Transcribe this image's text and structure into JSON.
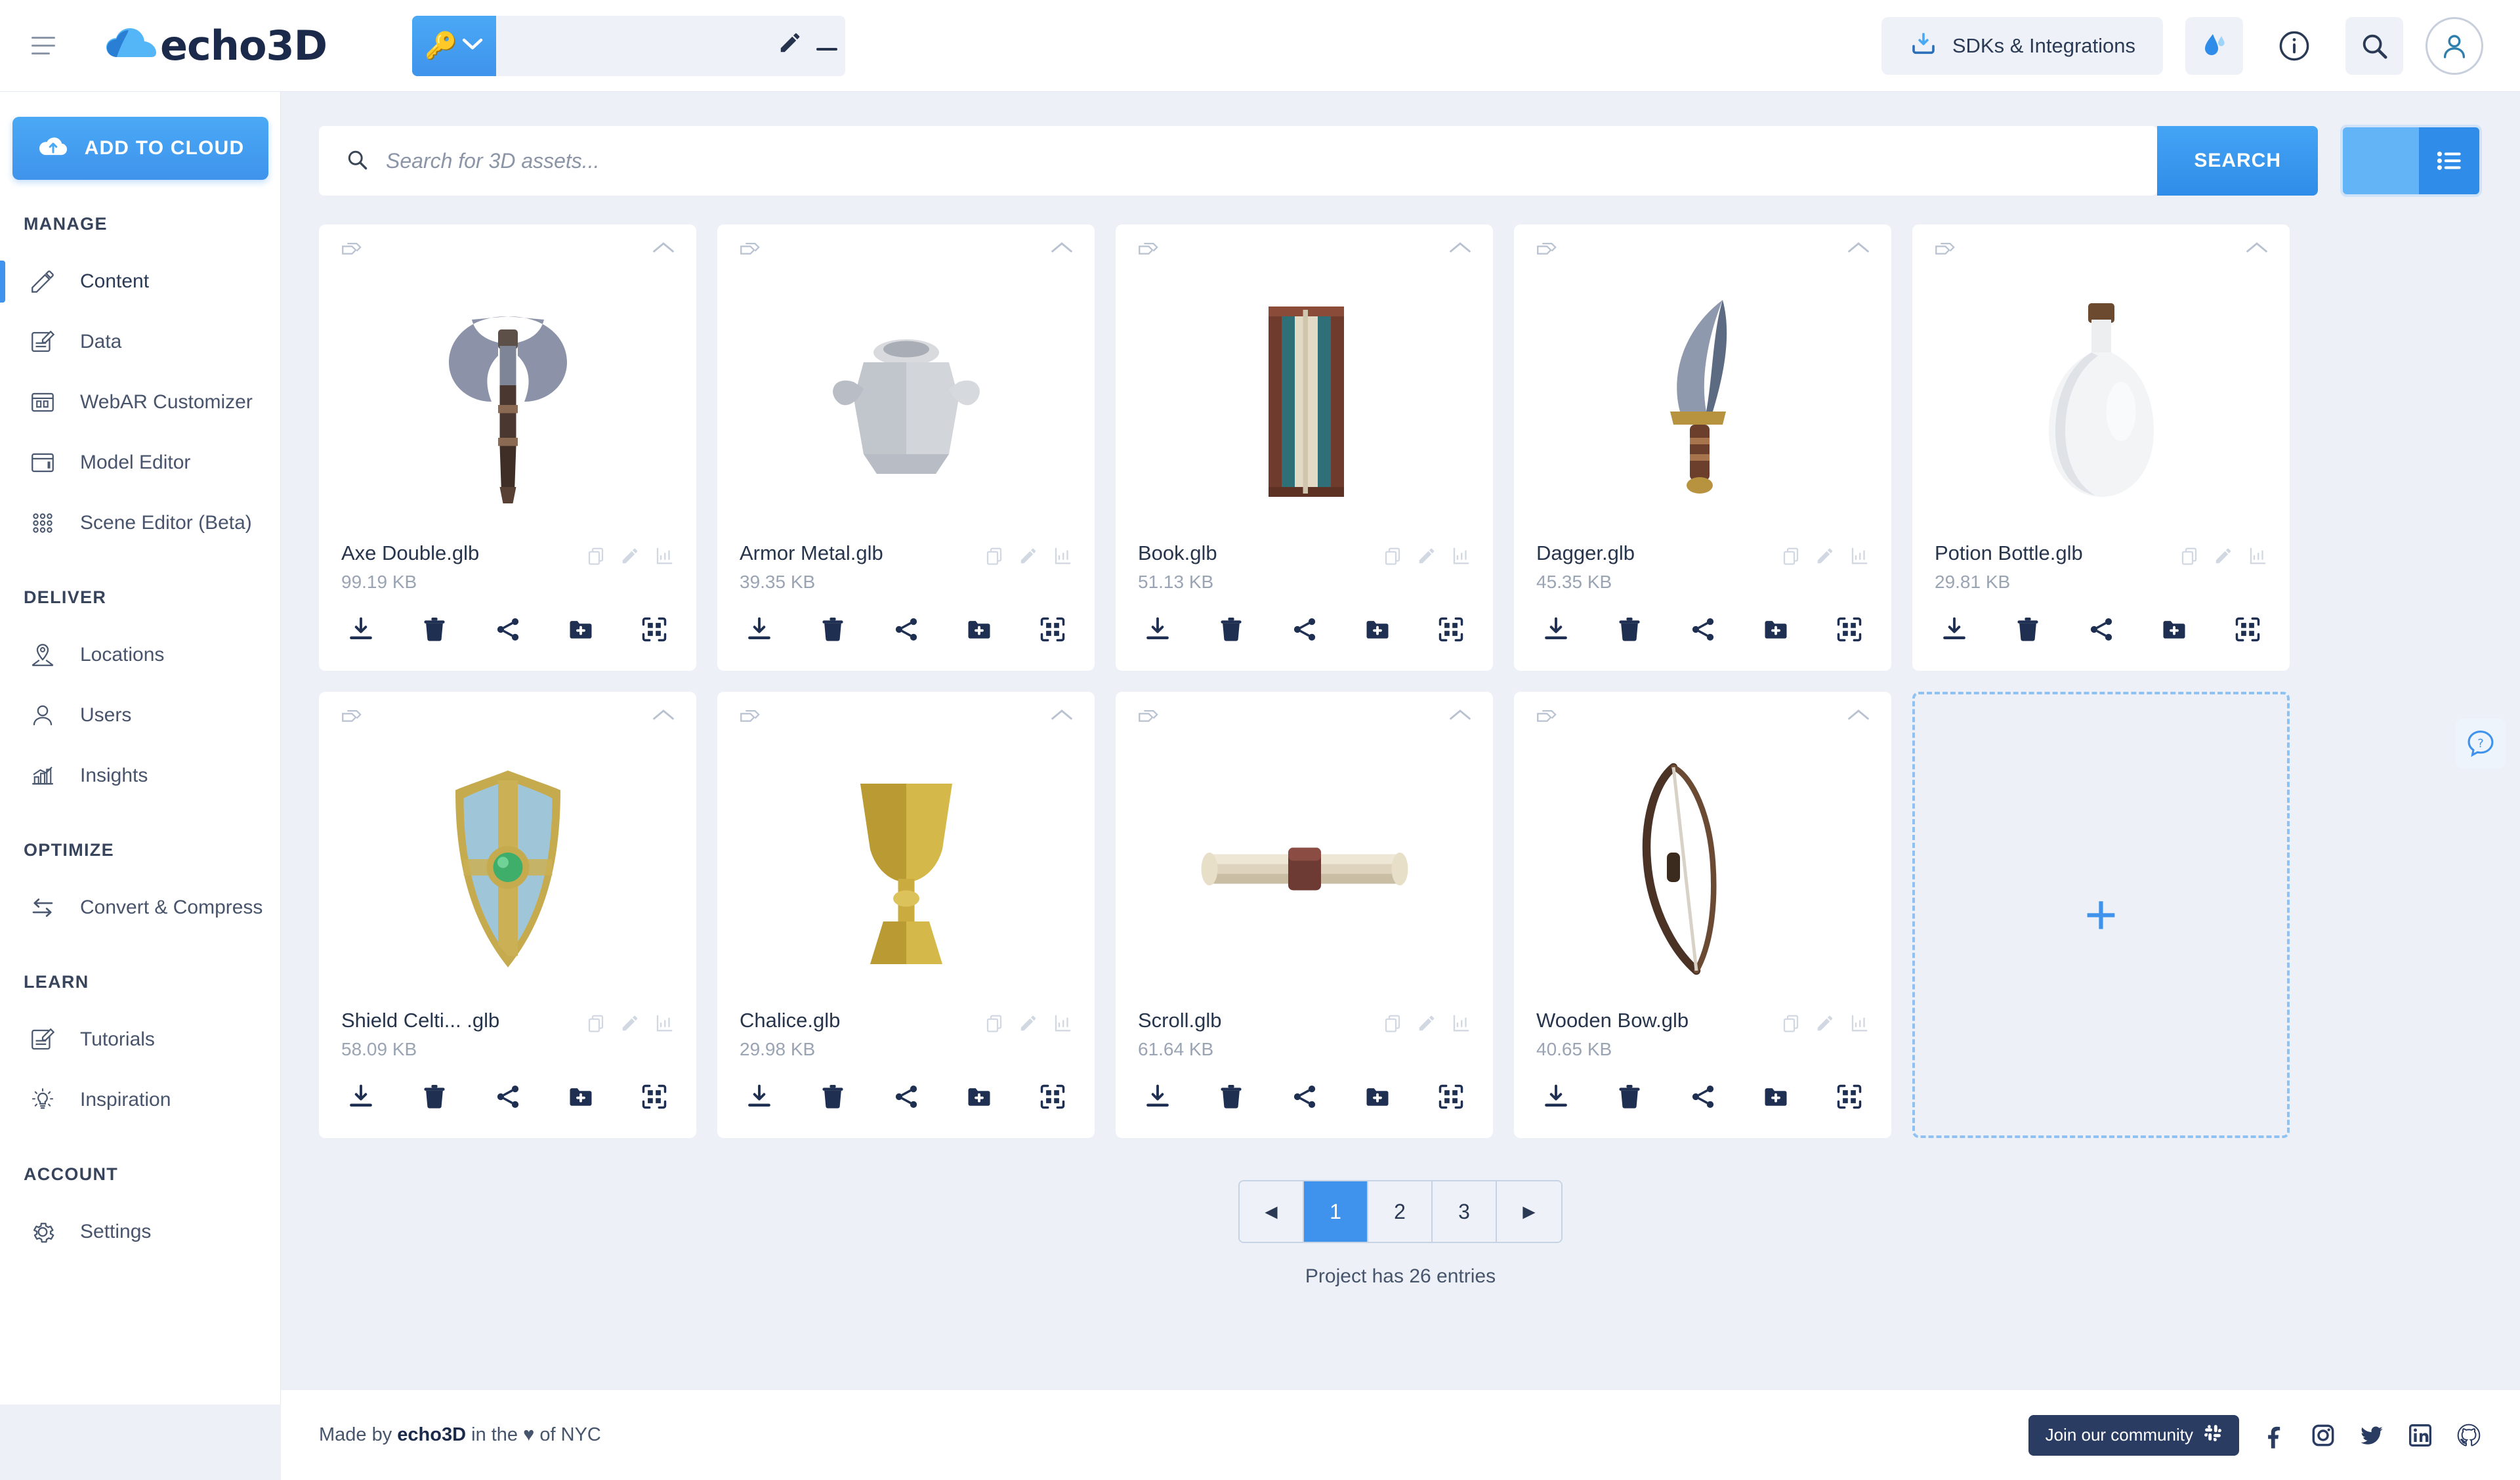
{
  "brand": {
    "name": "echo3D",
    "accent": "#3f93ec",
    "dark": "#1b2a4a"
  },
  "header": {
    "logo_text": "echo3D",
    "project_name": "",
    "sdk_label": "SDKs & Integrations"
  },
  "sidebar": {
    "add_button_label": "ADD TO CLOUD",
    "sections": [
      {
        "title": "MANAGE",
        "items": [
          {
            "label": "Content",
            "icon": "pencil-icon",
            "active": true
          },
          {
            "label": "Data",
            "icon": "data-edit-icon",
            "active": false
          },
          {
            "label": "WebAR Customizer",
            "icon": "webar-icon",
            "active": false
          },
          {
            "label": "Model Editor",
            "icon": "model-editor-icon",
            "active": false
          },
          {
            "label": "Scene Editor (Beta)",
            "icon": "scene-editor-icon",
            "active": false
          }
        ]
      },
      {
        "title": "DELIVER",
        "items": [
          {
            "label": "Locations",
            "icon": "location-pin-icon",
            "active": false
          },
          {
            "label": "Users",
            "icon": "user-icon",
            "active": false
          },
          {
            "label": "Insights",
            "icon": "chart-bar-icon",
            "active": false
          }
        ]
      },
      {
        "title": "OPTIMIZE",
        "items": [
          {
            "label": "Convert & Compress",
            "icon": "convert-arrows-icon",
            "active": false
          }
        ]
      },
      {
        "title": "LEARN",
        "items": [
          {
            "label": "Tutorials",
            "icon": "tutorial-icon",
            "active": false
          },
          {
            "label": "Inspiration",
            "icon": "lightbulb-icon",
            "active": false
          }
        ]
      },
      {
        "title": "ACCOUNT",
        "items": [
          {
            "label": "Settings",
            "icon": "gear-icon",
            "active": false
          }
        ]
      }
    ]
  },
  "search": {
    "placeholder": "Search for 3D assets...",
    "value": "",
    "button_label": "SEARCH",
    "view_mode": "grid"
  },
  "assets": [
    {
      "name": "Axe Double.glb",
      "size": "99.19 KB",
      "model": "axe"
    },
    {
      "name": "Armor Metal.glb",
      "size": "39.35 KB",
      "model": "armor"
    },
    {
      "name": "Book.glb",
      "size": "51.13 KB",
      "model": "book"
    },
    {
      "name": "Dagger.glb",
      "size": "45.35 KB",
      "model": "dagger"
    },
    {
      "name": "Potion Bottle.glb",
      "size": "29.81 KB",
      "model": "potion"
    },
    {
      "name": "Shield Celti... .glb",
      "size": "58.09 KB",
      "model": "shield"
    },
    {
      "name": "Chalice.glb",
      "size": "29.98 KB",
      "model": "chalice"
    },
    {
      "name": "Scroll.glb",
      "size": "61.64 KB",
      "model": "scroll"
    },
    {
      "name": "Wooden Bow.glb",
      "size": "40.65 KB",
      "model": "bow"
    }
  ],
  "pagination": {
    "prev": "◄",
    "next": "►",
    "pages": [
      "1",
      "2",
      "3"
    ],
    "current": "1",
    "entries_text": "Project has 26 entries"
  },
  "footer": {
    "made_prefix": "Made by ",
    "made_brand": "echo3D",
    "made_suffix": " in the ♥ of NYC",
    "community_label": "Join our community"
  }
}
